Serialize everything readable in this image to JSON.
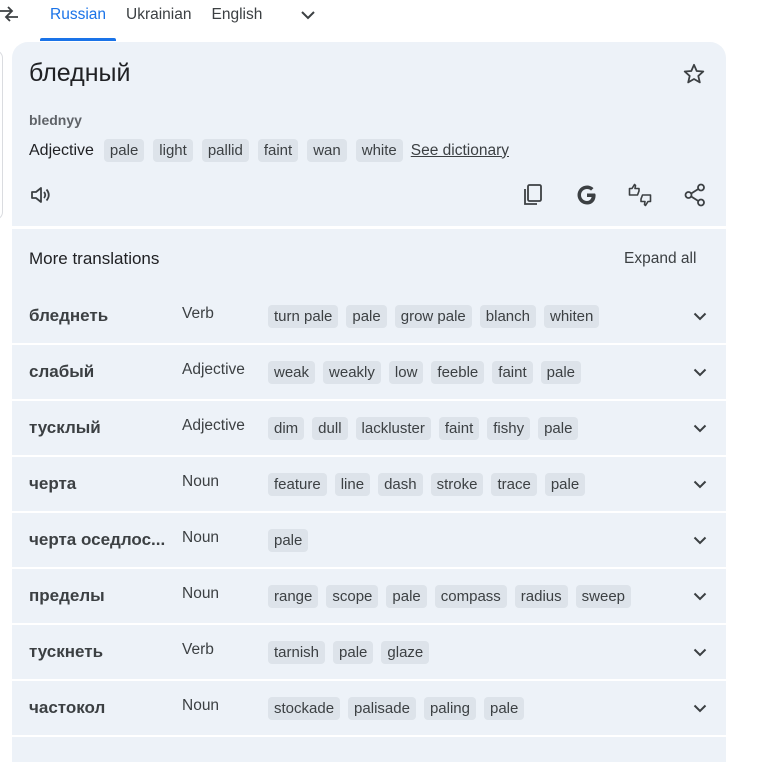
{
  "lang_bar": {
    "tabs": [
      {
        "label": "Russian",
        "active": true
      },
      {
        "label": "Ukrainian",
        "active": false
      },
      {
        "label": "English",
        "active": false
      }
    ]
  },
  "result": {
    "word": "бледный",
    "transliteration": "blednyy",
    "part_of_speech": "Adjective",
    "synonyms": [
      "pale",
      "light",
      "pallid",
      "faint",
      "wan",
      "white"
    ],
    "see_dictionary": "See dictionary"
  },
  "more_translations": {
    "title": "More translations",
    "expand_all": "Expand all",
    "rows": [
      {
        "word": "бледнеть",
        "pos": "Verb",
        "chips": [
          "turn pale",
          "pale",
          "grow pale",
          "blanch",
          "whiten"
        ]
      },
      {
        "word": "слабый",
        "pos": "Adjective",
        "chips": [
          "weak",
          "weakly",
          "low",
          "feeble",
          "faint",
          "pale"
        ]
      },
      {
        "word": "тусклый",
        "pos": "Adjective",
        "chips": [
          "dim",
          "dull",
          "lackluster",
          "faint",
          "fishy",
          "pale"
        ]
      },
      {
        "word": "черта",
        "pos": "Noun",
        "chips": [
          "feature",
          "line",
          "dash",
          "stroke",
          "trace",
          "pale"
        ]
      },
      {
        "word": "черта оседлос...",
        "pos": "Noun",
        "chips": [
          "pale"
        ]
      },
      {
        "word": "пределы",
        "pos": "Noun",
        "chips": [
          "range",
          "scope",
          "pale",
          "compass",
          "radius",
          "sweep"
        ]
      },
      {
        "word": "тускнеть",
        "pos": "Verb",
        "chips": [
          "tarnish",
          "pale",
          "glaze"
        ]
      },
      {
        "word": "частокол",
        "pos": "Noun",
        "chips": [
          "stockade",
          "palisade",
          "paling",
          "pale"
        ]
      }
    ]
  },
  "icons": {
    "swap": "swap-languages-icon",
    "more_languages": "chevron-down-icon",
    "star": "star-icon",
    "listen": "speaker-icon",
    "copy": "copy-icon",
    "google": "google-icon",
    "feedback": "rate-translation-icon",
    "share": "share-icon"
  },
  "colors": {
    "accent": "#1a73e8",
    "card_bg": "#edf2f8",
    "chip_bg": "#dde3ea"
  }
}
